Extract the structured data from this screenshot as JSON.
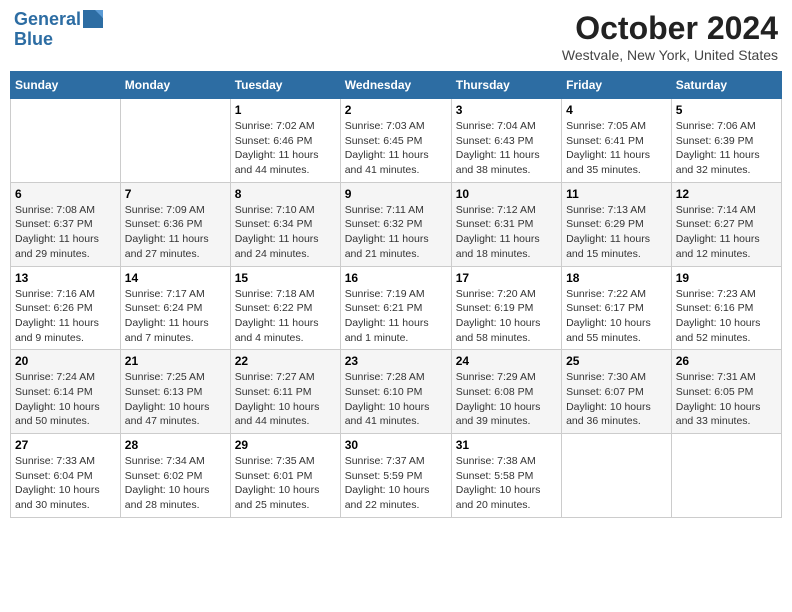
{
  "header": {
    "logo_line1": "General",
    "logo_line2": "Blue",
    "month": "October 2024",
    "location": "Westvale, New York, United States"
  },
  "days_of_week": [
    "Sunday",
    "Monday",
    "Tuesday",
    "Wednesday",
    "Thursday",
    "Friday",
    "Saturday"
  ],
  "weeks": [
    [
      {
        "day": "",
        "info": ""
      },
      {
        "day": "",
        "info": ""
      },
      {
        "day": "1",
        "info": "Sunrise: 7:02 AM\nSunset: 6:46 PM\nDaylight: 11 hours and 44 minutes."
      },
      {
        "day": "2",
        "info": "Sunrise: 7:03 AM\nSunset: 6:45 PM\nDaylight: 11 hours and 41 minutes."
      },
      {
        "day": "3",
        "info": "Sunrise: 7:04 AM\nSunset: 6:43 PM\nDaylight: 11 hours and 38 minutes."
      },
      {
        "day": "4",
        "info": "Sunrise: 7:05 AM\nSunset: 6:41 PM\nDaylight: 11 hours and 35 minutes."
      },
      {
        "day": "5",
        "info": "Sunrise: 7:06 AM\nSunset: 6:39 PM\nDaylight: 11 hours and 32 minutes."
      }
    ],
    [
      {
        "day": "6",
        "info": "Sunrise: 7:08 AM\nSunset: 6:37 PM\nDaylight: 11 hours and 29 minutes."
      },
      {
        "day": "7",
        "info": "Sunrise: 7:09 AM\nSunset: 6:36 PM\nDaylight: 11 hours and 27 minutes."
      },
      {
        "day": "8",
        "info": "Sunrise: 7:10 AM\nSunset: 6:34 PM\nDaylight: 11 hours and 24 minutes."
      },
      {
        "day": "9",
        "info": "Sunrise: 7:11 AM\nSunset: 6:32 PM\nDaylight: 11 hours and 21 minutes."
      },
      {
        "day": "10",
        "info": "Sunrise: 7:12 AM\nSunset: 6:31 PM\nDaylight: 11 hours and 18 minutes."
      },
      {
        "day": "11",
        "info": "Sunrise: 7:13 AM\nSunset: 6:29 PM\nDaylight: 11 hours and 15 minutes."
      },
      {
        "day": "12",
        "info": "Sunrise: 7:14 AM\nSunset: 6:27 PM\nDaylight: 11 hours and 12 minutes."
      }
    ],
    [
      {
        "day": "13",
        "info": "Sunrise: 7:16 AM\nSunset: 6:26 PM\nDaylight: 11 hours and 9 minutes."
      },
      {
        "day": "14",
        "info": "Sunrise: 7:17 AM\nSunset: 6:24 PM\nDaylight: 11 hours and 7 minutes."
      },
      {
        "day": "15",
        "info": "Sunrise: 7:18 AM\nSunset: 6:22 PM\nDaylight: 11 hours and 4 minutes."
      },
      {
        "day": "16",
        "info": "Sunrise: 7:19 AM\nSunset: 6:21 PM\nDaylight: 11 hours and 1 minute."
      },
      {
        "day": "17",
        "info": "Sunrise: 7:20 AM\nSunset: 6:19 PM\nDaylight: 10 hours and 58 minutes."
      },
      {
        "day": "18",
        "info": "Sunrise: 7:22 AM\nSunset: 6:17 PM\nDaylight: 10 hours and 55 minutes."
      },
      {
        "day": "19",
        "info": "Sunrise: 7:23 AM\nSunset: 6:16 PM\nDaylight: 10 hours and 52 minutes."
      }
    ],
    [
      {
        "day": "20",
        "info": "Sunrise: 7:24 AM\nSunset: 6:14 PM\nDaylight: 10 hours and 50 minutes."
      },
      {
        "day": "21",
        "info": "Sunrise: 7:25 AM\nSunset: 6:13 PM\nDaylight: 10 hours and 47 minutes."
      },
      {
        "day": "22",
        "info": "Sunrise: 7:27 AM\nSunset: 6:11 PM\nDaylight: 10 hours and 44 minutes."
      },
      {
        "day": "23",
        "info": "Sunrise: 7:28 AM\nSunset: 6:10 PM\nDaylight: 10 hours and 41 minutes."
      },
      {
        "day": "24",
        "info": "Sunrise: 7:29 AM\nSunset: 6:08 PM\nDaylight: 10 hours and 39 minutes."
      },
      {
        "day": "25",
        "info": "Sunrise: 7:30 AM\nSunset: 6:07 PM\nDaylight: 10 hours and 36 minutes."
      },
      {
        "day": "26",
        "info": "Sunrise: 7:31 AM\nSunset: 6:05 PM\nDaylight: 10 hours and 33 minutes."
      }
    ],
    [
      {
        "day": "27",
        "info": "Sunrise: 7:33 AM\nSunset: 6:04 PM\nDaylight: 10 hours and 30 minutes."
      },
      {
        "day": "28",
        "info": "Sunrise: 7:34 AM\nSunset: 6:02 PM\nDaylight: 10 hours and 28 minutes."
      },
      {
        "day": "29",
        "info": "Sunrise: 7:35 AM\nSunset: 6:01 PM\nDaylight: 10 hours and 25 minutes."
      },
      {
        "day": "30",
        "info": "Sunrise: 7:37 AM\nSunset: 5:59 PM\nDaylight: 10 hours and 22 minutes."
      },
      {
        "day": "31",
        "info": "Sunrise: 7:38 AM\nSunset: 5:58 PM\nDaylight: 10 hours and 20 minutes."
      },
      {
        "day": "",
        "info": ""
      },
      {
        "day": "",
        "info": ""
      }
    ]
  ]
}
